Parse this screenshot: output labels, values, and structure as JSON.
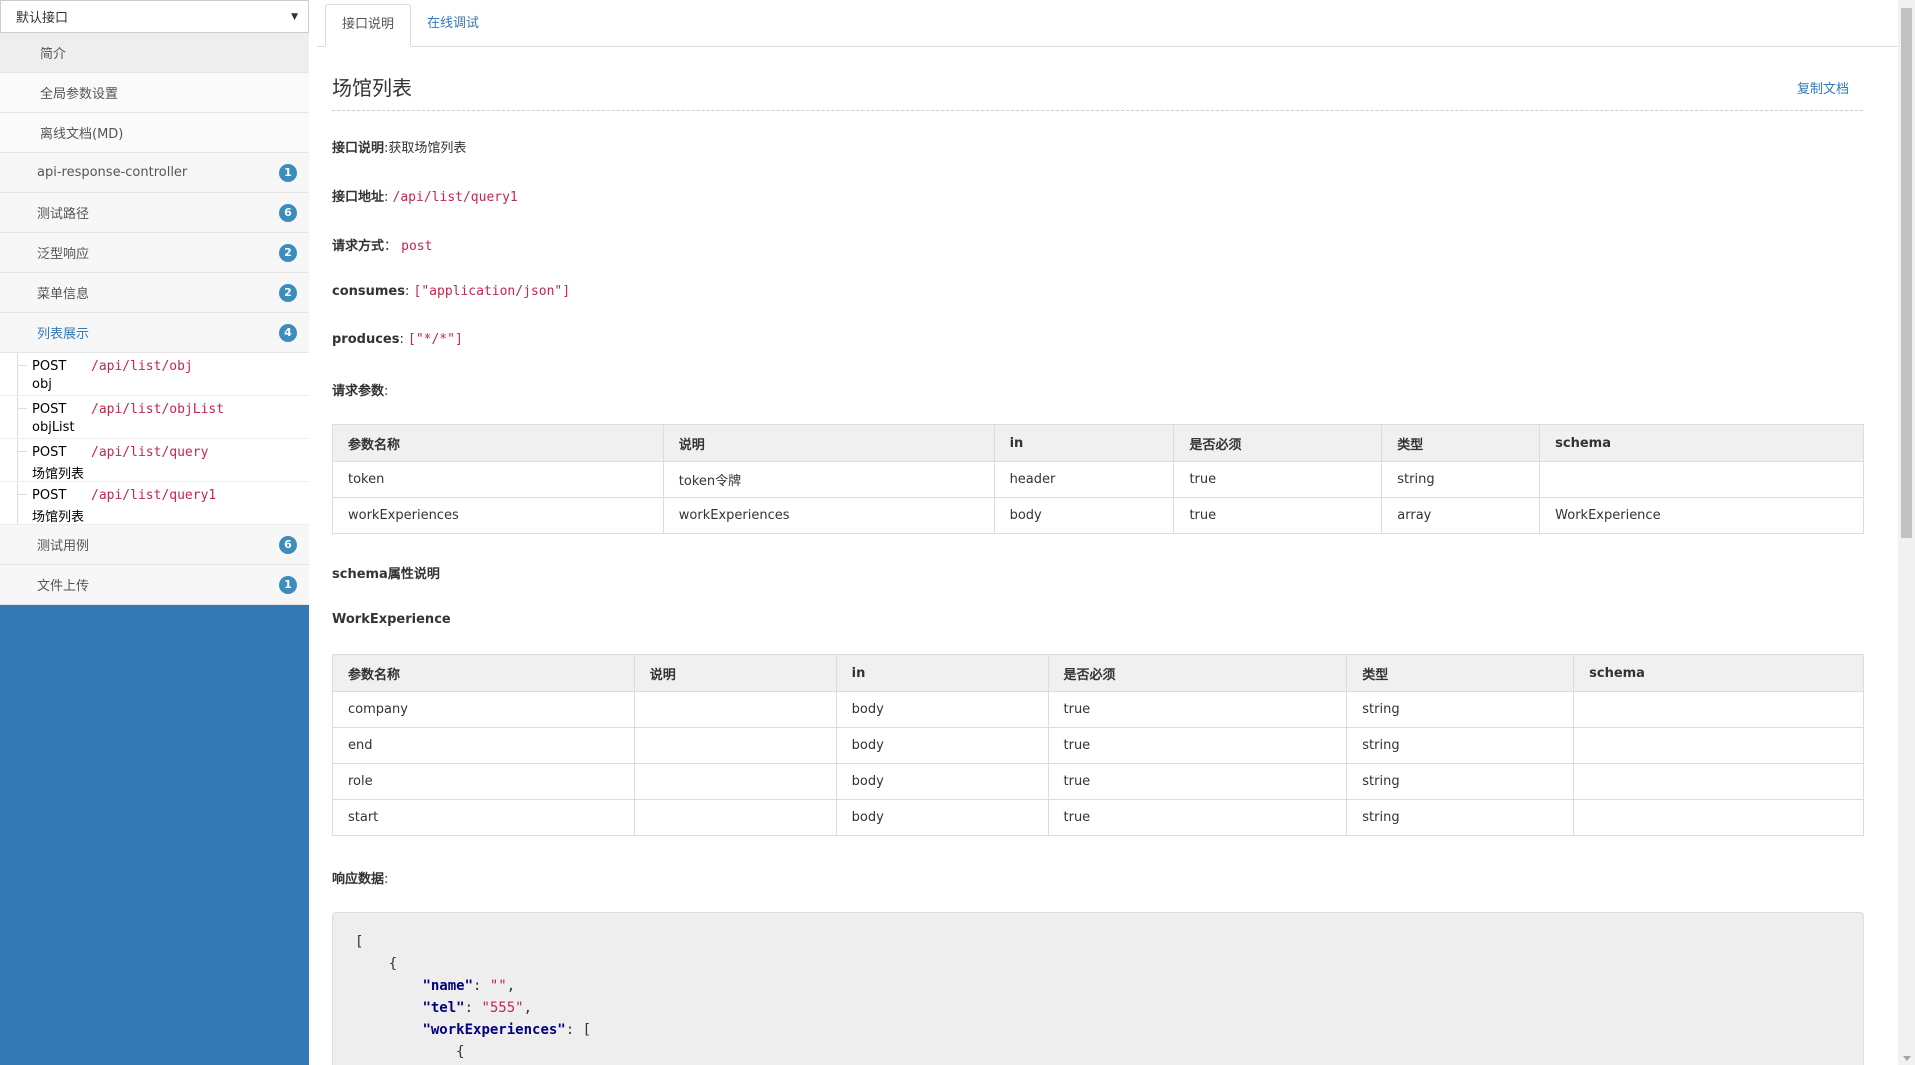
{
  "sidebar": {
    "group_select": "默认接口",
    "static_items": [
      {
        "label": "简介"
      },
      {
        "label": "全局参数设置"
      },
      {
        "label": "离线文档(MD)"
      }
    ],
    "tags": [
      {
        "label": "api-response-controller",
        "count": "1"
      },
      {
        "label": "测试路径",
        "count": "6"
      },
      {
        "label": "泛型响应",
        "count": "2"
      },
      {
        "label": "菜单信息",
        "count": "2"
      },
      {
        "label": "列表展示",
        "count": "4",
        "active": true
      },
      {
        "label": "测试用例",
        "count": "6"
      },
      {
        "label": "文件上传",
        "count": "1"
      }
    ],
    "apis": [
      {
        "method": "POST",
        "path": "/api/list/obj",
        "summary": "obj"
      },
      {
        "method": "POST",
        "path": "/api/list/objList",
        "summary": "objList"
      },
      {
        "method": "POST",
        "path": "/api/list/query",
        "summary": "场馆列表"
      },
      {
        "method": "POST",
        "path": "/api/list/query1",
        "summary": "场馆列表"
      }
    ]
  },
  "tabs": {
    "doc": "接口说明",
    "debug": "在线调试"
  },
  "doc": {
    "title": "场馆列表",
    "copy": "复制文档",
    "desc_label": "接口说明",
    "desc_value": "获取场馆列表",
    "url_label": "接口地址",
    "url_value": "/api/list/query1",
    "method_label": "请求方式",
    "method_value": "post",
    "consumes_label": "consumes",
    "consumes_value": "[\"application/json\"]",
    "produces_label": "produces",
    "produces_value": "[\"*/*\"]",
    "params_label": "请求参数",
    "schema_desc_label": "schema属性说明",
    "schema_name": "WorkExperience",
    "response_label": "响应数据"
  },
  "params_table": {
    "headers": [
      "参数名称",
      "说明",
      "in",
      "是否必须",
      "类型",
      "schema"
    ],
    "rows": [
      [
        "token",
        "token令牌",
        "header",
        "true",
        "string",
        ""
      ],
      [
        "workExperiences",
        "workExperiences",
        "body",
        "true",
        "array",
        "WorkExperience"
      ]
    ]
  },
  "schema_table": {
    "headers": [
      "参数名称",
      "说明",
      "in",
      "是否必须",
      "类型",
      "schema"
    ],
    "rows": [
      [
        "company",
        "",
        "body",
        "true",
        "string",
        ""
      ],
      [
        "end",
        "",
        "body",
        "true",
        "string",
        ""
      ],
      [
        "role",
        "",
        "body",
        "true",
        "string",
        ""
      ],
      [
        "start",
        "",
        "body",
        "true",
        "string",
        ""
      ]
    ]
  },
  "response_json": {
    "open_bracket": "[",
    "open_brace": "{",
    "k_name": "\"name\"",
    "v_name": "\"\"",
    "k_tel": "\"tel\"",
    "v_tel": "\"555\"",
    "k_work": "\"workExperiences\"",
    "v_work": "[",
    "inner_brace": "{"
  },
  "colors": {
    "accent": "#337ab7",
    "code": "#c7254e",
    "badge": "#3c8dbc"
  }
}
